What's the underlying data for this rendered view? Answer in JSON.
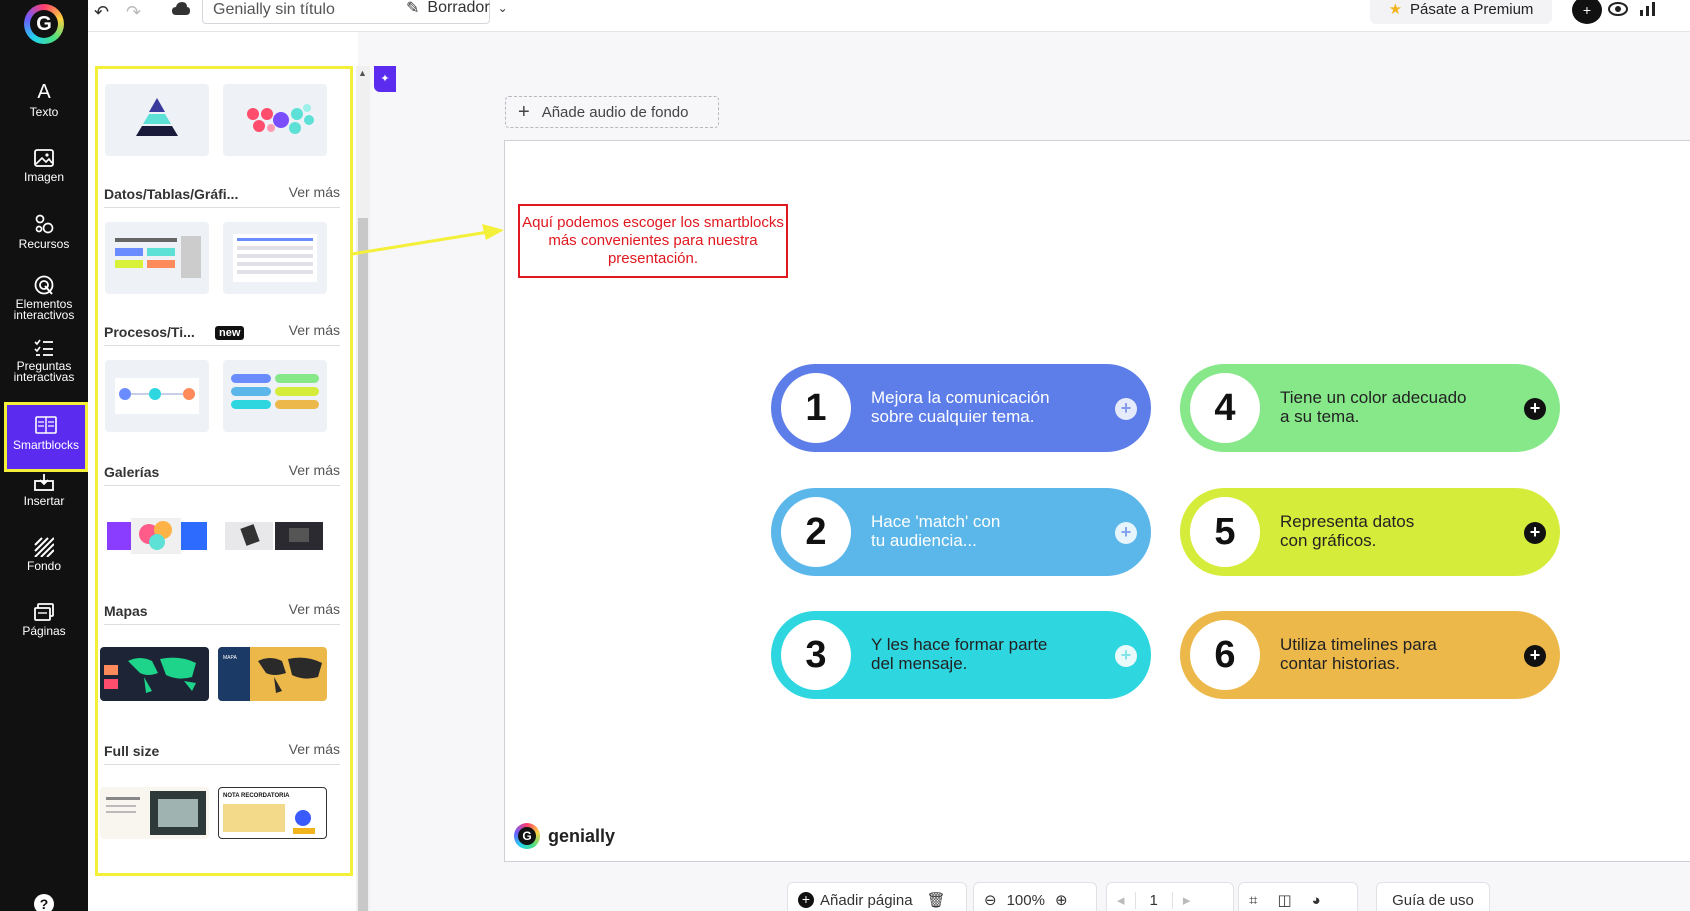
{
  "rail": {
    "items": [
      {
        "label": "Texto",
        "icon": "text-icon"
      },
      {
        "label": "Imagen",
        "icon": "image-icon"
      },
      {
        "label": "Recursos",
        "icon": "resources-icon"
      },
      {
        "label": "Elementos interactivos",
        "icon": "interactive-elements-icon"
      },
      {
        "label": "Preguntas interactivas",
        "icon": "interactive-questions-icon"
      },
      {
        "label": "Smartblocks",
        "icon": "smartblocks-icon"
      },
      {
        "label": "Insertar",
        "icon": "insert-icon"
      },
      {
        "label": "Fondo",
        "icon": "background-icon"
      },
      {
        "label": "Páginas",
        "icon": "pages-icon"
      }
    ],
    "selected": "Smartblocks",
    "help": "?"
  },
  "topbar": {
    "title": "Genially sin título",
    "draft": "Borrador",
    "premium": "Pásate a Premium"
  },
  "panel": {
    "sections": [
      {
        "title": "Datos/Tablas/Gráfi...",
        "more": "Ver más",
        "badge": ""
      },
      {
        "title": "Procesos/Ti...",
        "more": "Ver más",
        "badge": "new"
      },
      {
        "title": "Galerías",
        "more": "Ver más",
        "badge": ""
      },
      {
        "title": "Mapas",
        "more": "Ver más",
        "badge": ""
      },
      {
        "title": "Full size",
        "more": "Ver más",
        "badge": ""
      }
    ],
    "thumb_texts": {
      "nota": "NOTA RECORDATORIA",
      "mapa": "MAPA"
    }
  },
  "canvas": {
    "audio_button": "Añade audio de fondo",
    "callout": "Aquí podemos escoger los smartblocks más convenientes para nuestra presentación.",
    "brand": "genially",
    "pills": [
      {
        "num": "1",
        "text": "Mejora la comunicación\nsobre cualquier tema.",
        "color": "#5d7ee8"
      },
      {
        "num": "2",
        "text": "Hace 'match' con\ntu audiencia...",
        "color": "#5bb6ea"
      },
      {
        "num": "3",
        "text": "Y les hace formar parte\ndel mensaje.",
        "color": "#2ed6e0"
      },
      {
        "num": "4",
        "text": "Tiene un color adecuado\na su tema.",
        "color": "#86e889"
      },
      {
        "num": "5",
        "text": "Representa datos\ncon gráficos.",
        "color": "#d6ec3a"
      },
      {
        "num": "6",
        "text": "Utiliza timelines para\ncontar historias.",
        "color": "#ecb84a"
      }
    ]
  },
  "bottombar": {
    "add_page": "Añadir página",
    "zoom": "100%",
    "page": "1",
    "guide": "Guía de uso"
  },
  "colors": {
    "accent": "#5b2bf0",
    "highlight": "#f4f03a",
    "callout_red": "#e0181f"
  }
}
